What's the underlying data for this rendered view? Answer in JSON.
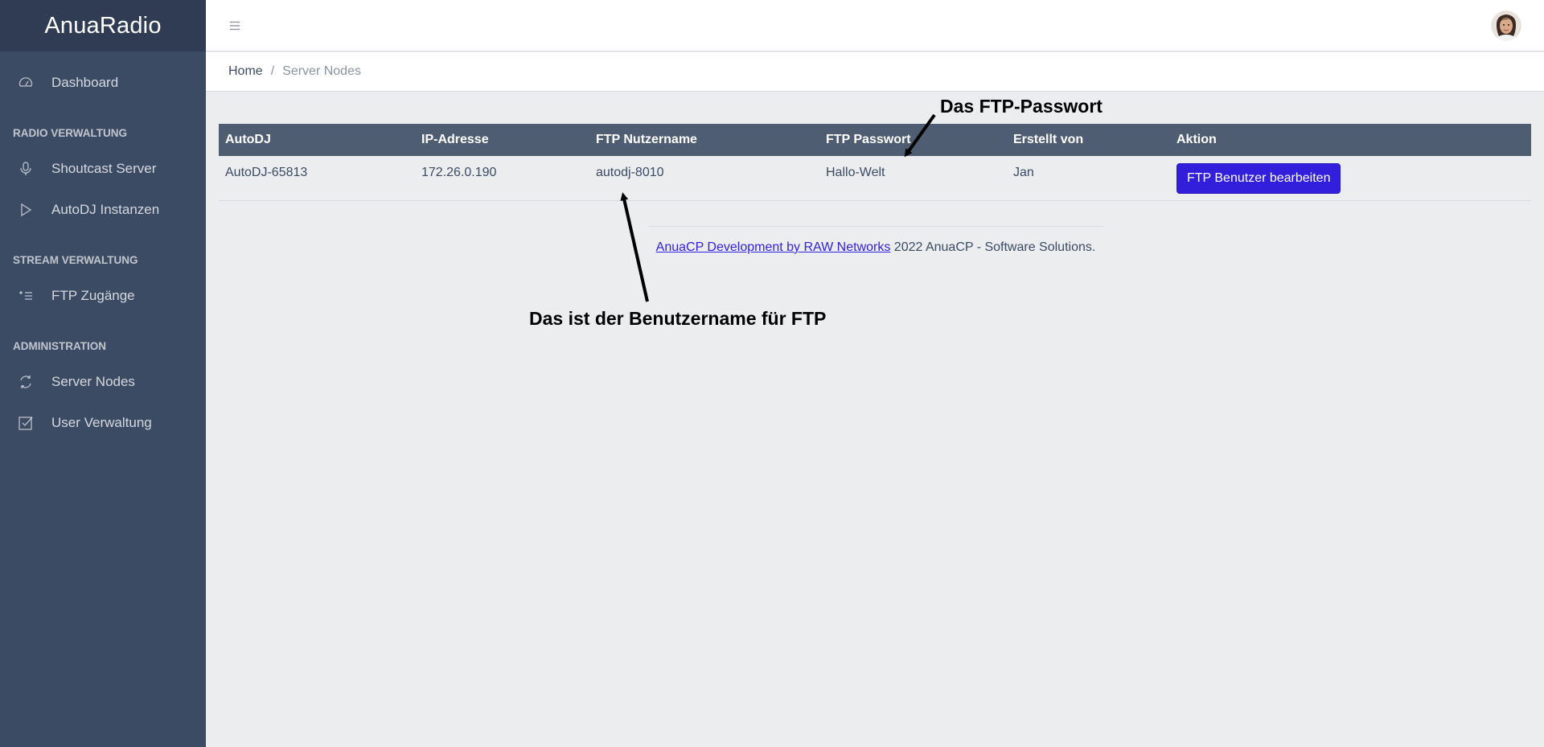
{
  "sidebar": {
    "brand": "AnuaRadio",
    "items": {
      "dashboard": "Dashboard",
      "shoutcast": "Shoutcast Server",
      "autodj": "AutoDJ Instanzen",
      "ftp": "FTP Zugänge",
      "server_nodes": "Server Nodes",
      "user_verwaltung": "User Verwaltung"
    },
    "titles": {
      "radio": "RADIO VERWALTUNG",
      "stream": "STREAM VERWALTUNG",
      "admin": "ADMINISTRATION"
    }
  },
  "header": {
    "toggler_icon": "hamburger-icon",
    "avatar": "user-avatar"
  },
  "breadcrumb": {
    "home": "Home",
    "separator": "/",
    "active": "Server Nodes"
  },
  "table": {
    "headers": [
      "AutoDJ",
      "IP-Adresse",
      "FTP Nutzername",
      "FTP Passwort",
      "Erstellt von",
      "Aktion"
    ],
    "rows": [
      {
        "autodj": "AutoDJ-65813",
        "ip": "172.26.0.190",
        "ftp_user": "autodj-8010",
        "ftp_pass": "Hallo-Welt",
        "created_by": "Jan",
        "action": "FTP Benutzer bearbeiten"
      }
    ]
  },
  "footer": {
    "link": "AnuaCP Development by RAW Networks",
    "text": " 2022 AnuaCP - Software Solutions."
  },
  "annotations": {
    "password": "Das FTP-Passwort",
    "username": "Das ist der Benutzername für FTP"
  },
  "colors": {
    "sidebar": "#3c4b64",
    "brand": "#303c54",
    "table_head": "#4f5d73",
    "primary": "#321fdb",
    "background": "#ebedef"
  }
}
